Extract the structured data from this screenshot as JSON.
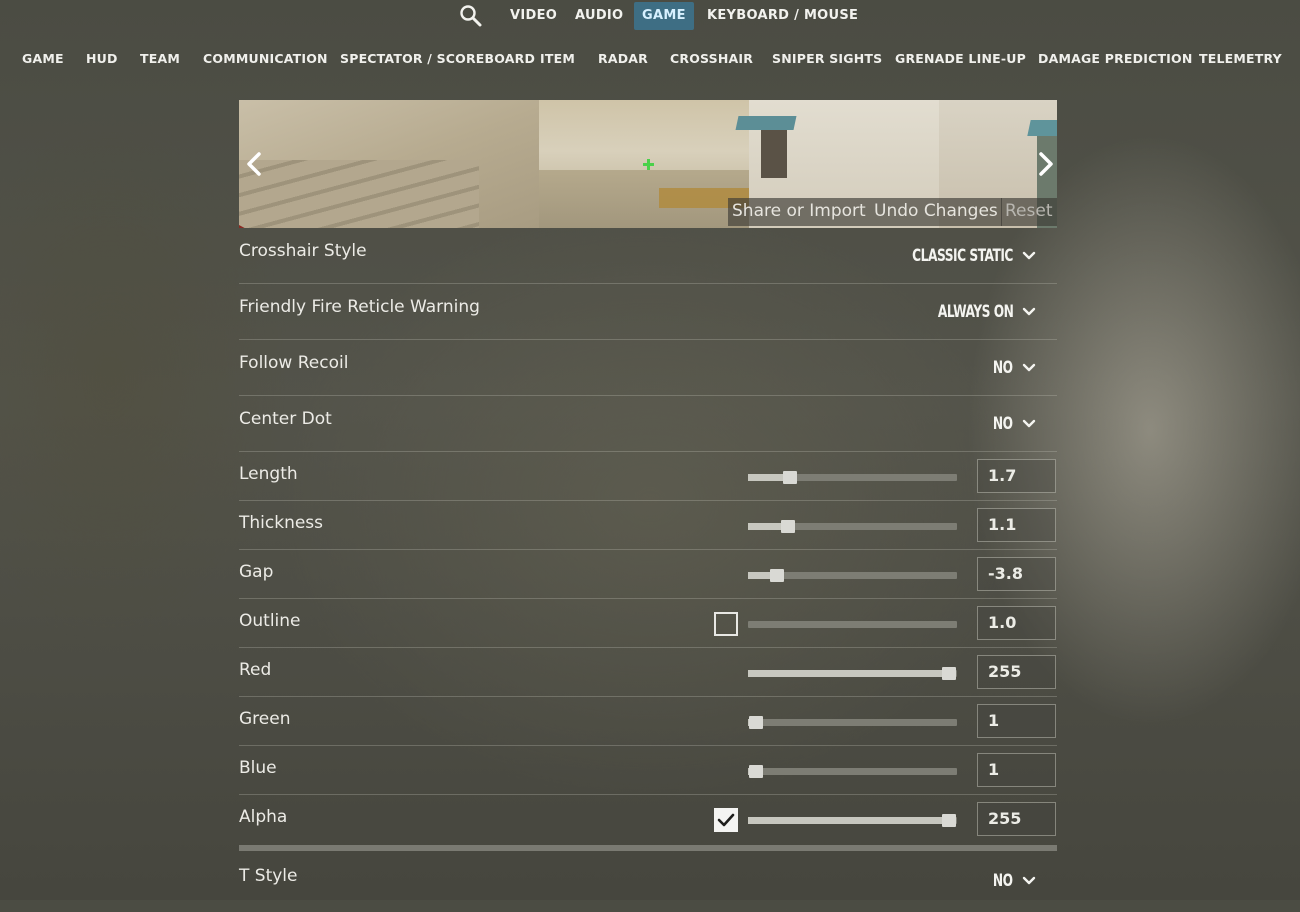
{
  "topnav": {
    "tabs": [
      {
        "label": "VIDEO"
      },
      {
        "label": "AUDIO"
      },
      {
        "label": "GAME",
        "active": true
      },
      {
        "label": "KEYBOARD / MOUSE"
      }
    ],
    "search_icon": "search-icon"
  },
  "subnav": {
    "tabs": [
      {
        "label": "GAME"
      },
      {
        "label": "HUD"
      },
      {
        "label": "TEAM"
      },
      {
        "label": "COMMUNICATION"
      },
      {
        "label": "SPECTATOR / SCOREBOARD"
      },
      {
        "label": "ITEM"
      },
      {
        "label": "RADAR"
      },
      {
        "label": "CROSSHAIR"
      },
      {
        "label": "SNIPER SIGHTS"
      },
      {
        "label": "GRENADE LINE-UP"
      },
      {
        "label": "DAMAGE PREDICTION"
      },
      {
        "label": "TELEMETRY"
      }
    ]
  },
  "preview": {
    "share_label": "Share or Import",
    "undo_label": "Undo Changes",
    "reset_label": "Reset",
    "prev_icon": "chevron-left-icon",
    "next_icon": "chevron-right-icon",
    "crosshair_color": "#4ad14a"
  },
  "settings": {
    "crosshair_style": {
      "label": "Crosshair Style",
      "value": "CLASSIC STATIC"
    },
    "friendly_fire": {
      "label": "Friendly Fire Reticle Warning",
      "value": "ALWAYS ON"
    },
    "follow_recoil": {
      "label": "Follow Recoil",
      "value": "NO"
    },
    "center_dot": {
      "label": "Center Dot",
      "value": "NO"
    },
    "length": {
      "label": "Length",
      "value": "1.7",
      "fraction": 0.2
    },
    "thickness": {
      "label": "Thickness",
      "value": "1.1",
      "fraction": 0.19
    },
    "gap": {
      "label": "Gap",
      "value": "-3.8",
      "fraction": 0.14
    },
    "outline": {
      "label": "Outline",
      "value": "1.0",
      "fraction": 0,
      "checked": false
    },
    "red": {
      "label": "Red",
      "value": "255",
      "fraction": 0.96
    },
    "green": {
      "label": "Green",
      "value": "1",
      "fraction": 0.04
    },
    "blue": {
      "label": "Blue",
      "value": "1",
      "fraction": 0.04
    },
    "alpha": {
      "label": "Alpha",
      "value": "255",
      "fraction": 0.96,
      "checked": true
    },
    "t_style": {
      "label": "T Style",
      "value": "NO"
    }
  },
  "colors": {
    "active_tab_bg": "#3e6e84",
    "slider_track": "#7d7d74",
    "slider_fill": "#c7c7bf"
  }
}
